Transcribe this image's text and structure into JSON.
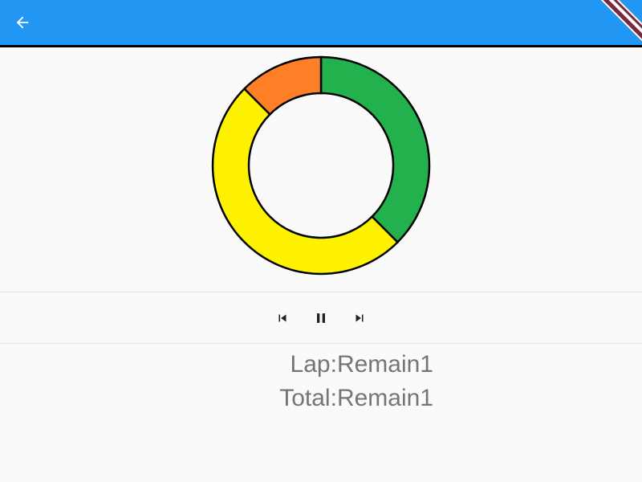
{
  "appbar": {
    "color": "#2196f3",
    "back_icon": "arrow-back-icon"
  },
  "chart_data": {
    "type": "pie",
    "donut": true,
    "slices": [
      {
        "value": 0.375,
        "color": "#22b14c"
      },
      {
        "value": 0.5,
        "color": "#fff200"
      },
      {
        "value": 0.125,
        "color": "#ff7f27"
      }
    ]
  },
  "controls": {
    "previous_icon": "skip-previous-icon",
    "pause_icon": "pause-icon",
    "next_icon": "skip-next-icon"
  },
  "info": {
    "lap": {
      "label": "Lap",
      "separator": ":",
      "value": "Remain1"
    },
    "total": {
      "label": "Total",
      "separator": ":",
      "value": "Remain1"
    }
  }
}
